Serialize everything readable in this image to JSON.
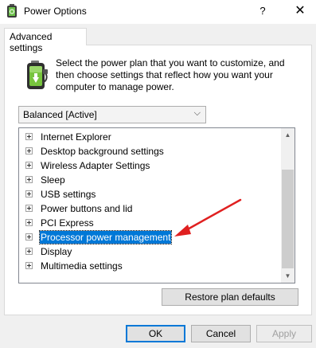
{
  "window": {
    "title": "Power Options",
    "help_glyph": "?",
    "close_glyph": "✕"
  },
  "tabs": [
    {
      "label": "Advanced settings",
      "selected": true
    }
  ],
  "description": "Select the power plan that you want to customize, and then choose settings that reflect how you want your computer to manage power.",
  "plan_select": {
    "value": "Balanced [Active]",
    "chevron": "⌵"
  },
  "tree": {
    "items": [
      {
        "label": "Internet Explorer"
      },
      {
        "label": "Desktop background settings"
      },
      {
        "label": "Wireless Adapter Settings"
      },
      {
        "label": "Sleep"
      },
      {
        "label": "USB settings"
      },
      {
        "label": "Power buttons and lid"
      },
      {
        "label": "PCI Express"
      },
      {
        "label": "Processor power management",
        "selected": true
      },
      {
        "label": "Display"
      },
      {
        "label": "Multimedia settings"
      }
    ]
  },
  "scrollbar": {
    "up_glyph": "▲",
    "down_glyph": "▼"
  },
  "buttons": {
    "restore": "Restore plan defaults",
    "ok": "OK",
    "cancel": "Cancel",
    "apply": "Apply"
  },
  "colors": {
    "selection": "#0078d7",
    "annotation_arrow": "#e02020"
  }
}
